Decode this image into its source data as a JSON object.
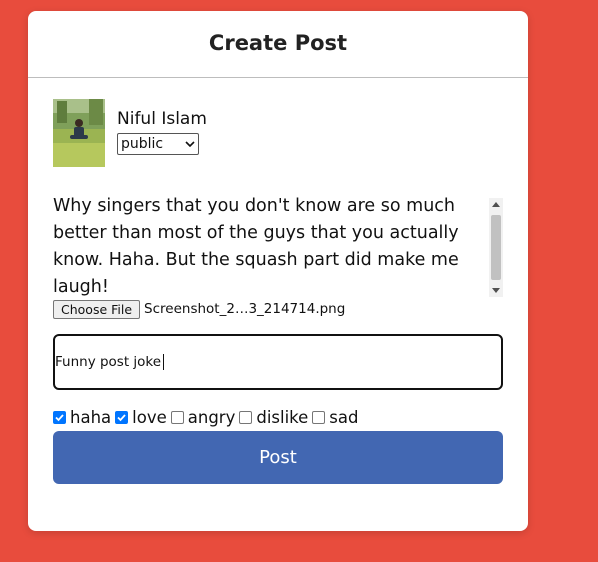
{
  "card": {
    "title": "Create Post"
  },
  "user": {
    "name": "Niful Islam",
    "privacy_value": "public"
  },
  "post": {
    "text": "Why singers that you don't know are so much better than most of the guys that you actually know. Haha. But the squash part did make me laugh!"
  },
  "file": {
    "button_label": "Choose File",
    "filename": "Screenshot_2…3_214714.png"
  },
  "caption": {
    "value": "Funny post joke"
  },
  "reactions": [
    {
      "label": "haha",
      "checked": true
    },
    {
      "label": "love",
      "checked": true
    },
    {
      "label": "angry",
      "checked": false
    },
    {
      "label": "dislike",
      "checked": false
    },
    {
      "label": "sad",
      "checked": false
    }
  ],
  "actions": {
    "post_label": "Post"
  },
  "colors": {
    "background": "#e84c3d",
    "post_button": "#4267b2",
    "checkbox_checked": "#0075ff"
  }
}
